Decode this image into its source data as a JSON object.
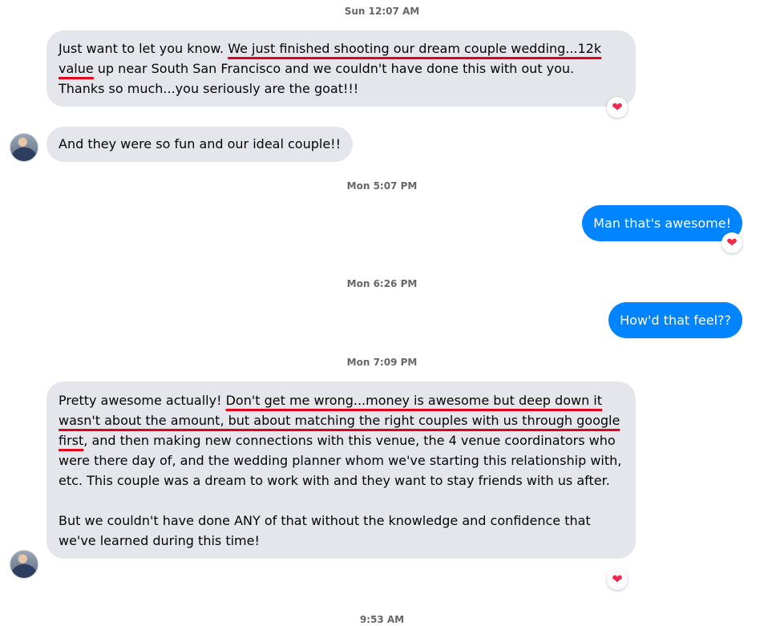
{
  "timestamps": {
    "t1": "Sun 12:07 AM",
    "t2": "Mon 5:07 PM",
    "t3": "Mon 6:26 PM",
    "t4": "Mon 7:09 PM",
    "t5": "9:53 AM"
  },
  "messages": {
    "m1": {
      "a": "Just want to let you know. ",
      "b": "We just finished shooting our dream couple wedding...12k value",
      "c": " up near South San Francisco and we couldn't have done this with out you. Thanks so much...you seriously are the goat!!!",
      "reaction": "❤"
    },
    "m2": {
      "text": "And they were so fun and our ideal couple!!"
    },
    "m3": {
      "text": "Man that's awesome!",
      "reaction": "❤"
    },
    "m4": {
      "text": "How'd that feel??"
    },
    "m5": {
      "a": "Pretty awesome actually! ",
      "b": "Don't get me wrong...money is awesome but deep down it wasn't about the amount, but about matching the right couples with us through google first",
      "c": ", and then making new connections with this venue, the 4 venue coordinators who were there day of, and the wedding planner whom we've starting this relationship with, etc. This couple was a dream to work with and they want to stay friends with us after.",
      "p2": "But we couldn't have done ANY of that without the knowledge and confidence that we've learned during this time!",
      "reaction": "❤"
    }
  },
  "colors": {
    "incoming_bubble": "#e4e6eb",
    "outgoing_bubble": "#0084ff",
    "underline": "#e4001b",
    "heart": "#f02849"
  }
}
